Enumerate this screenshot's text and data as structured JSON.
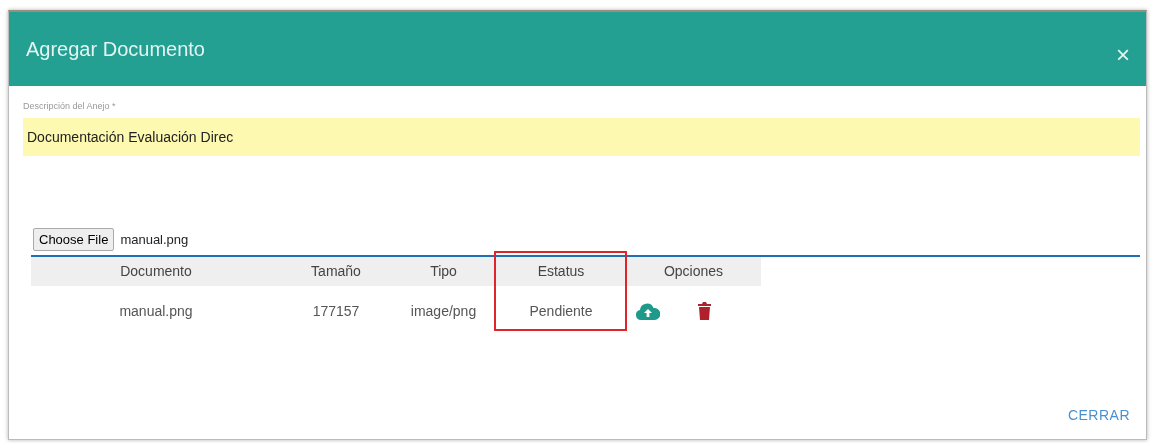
{
  "modal": {
    "title": "Agregar Documento",
    "close": "×"
  },
  "description": {
    "label": "Descripción del Anejo *",
    "value": "Documentación Evaluación Direc"
  },
  "file_input": {
    "button": "Choose File",
    "file_name": "manual.png"
  },
  "table": {
    "columns": [
      {
        "label": "Documento",
        "highlighted": false
      },
      {
        "label": "Tamaño",
        "highlighted": false
      },
      {
        "label": "Tipo",
        "highlighted": false
      },
      {
        "label": "Estatus",
        "highlighted": true
      },
      {
        "label": "Opciones",
        "highlighted": false
      }
    ],
    "rows": [
      {
        "cells": [
          "manual.png",
          "177157",
          "image/png",
          "Pendiente"
        ]
      }
    ]
  },
  "footer": {
    "button": "CERRAR"
  }
}
